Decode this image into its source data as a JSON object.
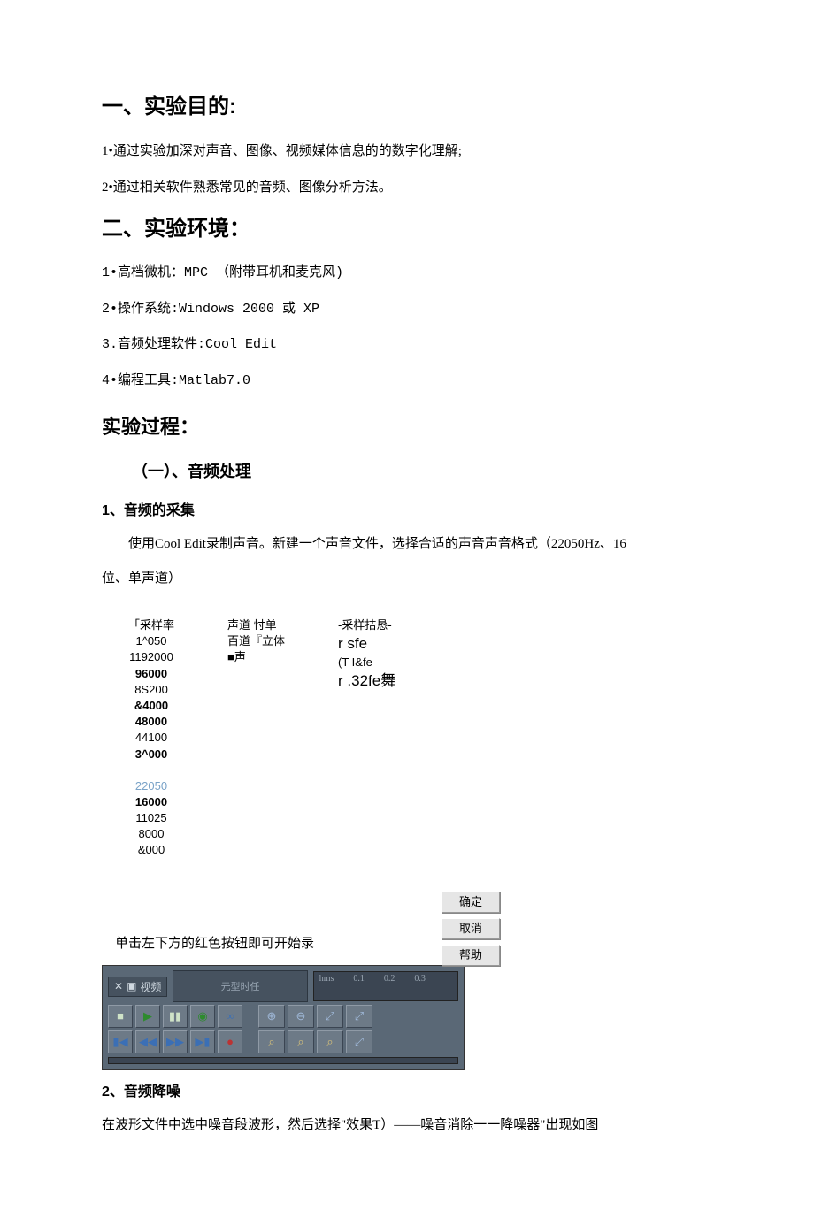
{
  "headings": {
    "h1": "一、实验目的:",
    "h2": "二、实验环境：",
    "h3": "实验过程：",
    "h4": "（一）、音频处理",
    "h5": "1、音频的采集",
    "h6": "2、音频降噪"
  },
  "purpose": {
    "p1": "1•通过实验加深对声音、图像、视频媒体信息的的数字化理解;",
    "p2": "2•通过相关软件熟悉常见的音频、图像分析方法。"
  },
  "env": {
    "e1": "1•高档微机：MPC （附带耳机和麦克风)",
    "e2": "2•操作系统:Windows 2000 或 XP",
    "e3": "3.音频处理软件:Cool Edit",
    "e4": "4•编程工具:Matlab7.0"
  },
  "capture": {
    "p1": "使用Cool Edit录制声音。新建一个声音文件，选择合适的声音声音格式（22050Hz、16",
    "p2": "位、单声道）"
  },
  "dialog": {
    "sample_rate_label": "「采样率",
    "rates": [
      "1^050",
      "1192000",
      "96000",
      "8S200",
      "&4000",
      "48000",
      "44100",
      "3^000"
    ],
    "rates2_highlight": "22050",
    "rates2": [
      "16000",
      "11025",
      "8000",
      "&000"
    ],
    "channel_label1": "声道 忖单",
    "channel_label2": "百道『立体",
    "channel_label3": "■声",
    "fmt_label": "-采样拮恳-",
    "fmt1": "r sfe",
    "fmt2": "(T I&fe",
    "fmt3": "r .32fe舞",
    "btn_ok": "确定",
    "btn_cancel": "取消",
    "btn_help": "帮助"
  },
  "click_record": "单击左下方的红色按钮即可开始录",
  "toolbar": {
    "tab_x": "✕",
    "tab_box": "▣",
    "tab_label": "视频",
    "seg_label": "元型时任",
    "ruler": {
      "hms": "hms",
      "t1": "0.1",
      "t2": "0.2",
      "t3": "0.3"
    },
    "playback": {
      "stop": "■",
      "play": "▶",
      "pause": "▮▮",
      "cycle": "◉",
      "loop": "∞",
      "first": "▮◀",
      "rew": "◀◀",
      "ffwd": "▶▶",
      "last": "▶▮",
      "rec": "●"
    },
    "zoom": {
      "in": "⊕",
      "out": "⊖",
      "all": "⤢",
      "selR": "⤢",
      "z1": "⌕",
      "z2": "⌕",
      "z3": "⌕",
      "selL": "⤢"
    }
  },
  "noise": {
    "p1": "在波形文件中选中噪音段波形，然后选择\"效果T）――噪音消除一一降噪器\"出现如图"
  }
}
